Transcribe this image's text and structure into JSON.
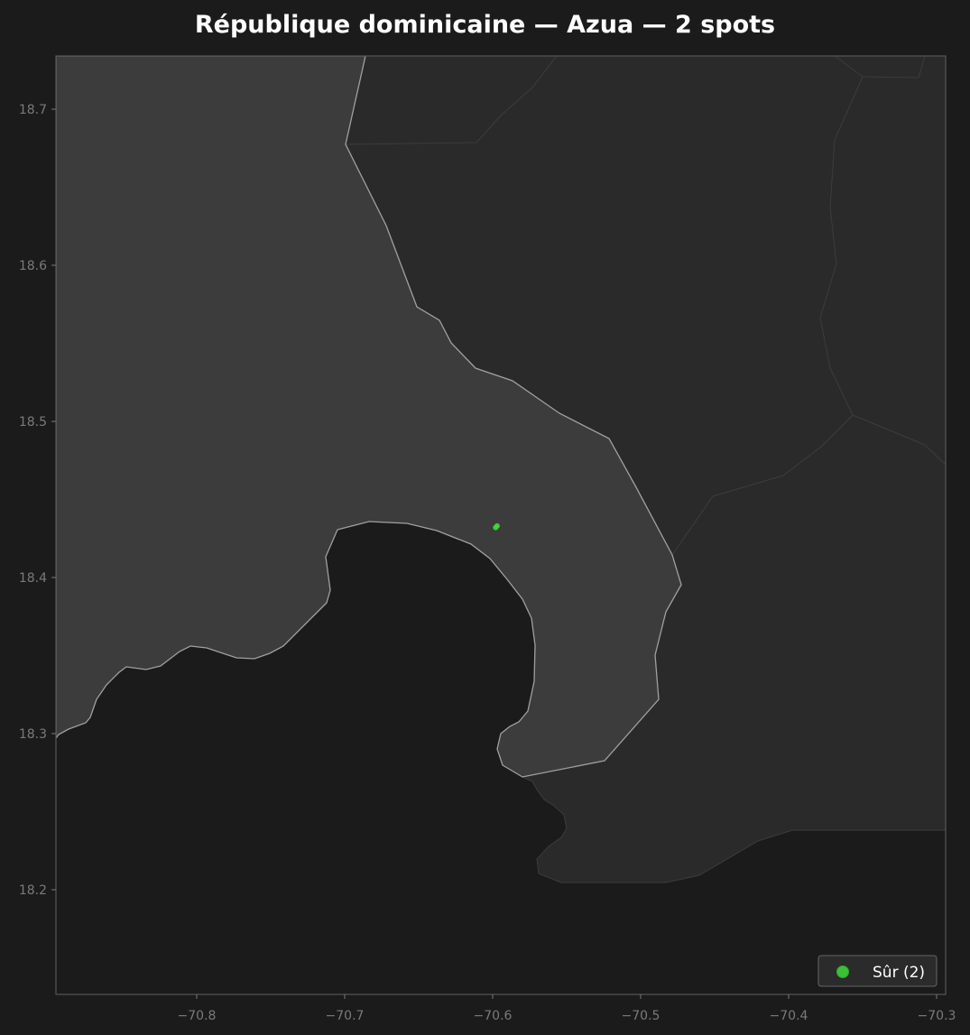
{
  "title": "République dominicaine — Azua — 2 spots",
  "colors": {
    "background": "#1b1b1b",
    "highlight_region": "#3c3c3c",
    "other_region": "#2a2a2a",
    "highlight_border": "#a0a0a0",
    "other_border": "#3c3c3c",
    "axis": "#555555",
    "tick_label": "#7a7a7a",
    "spot": "#3ddc38",
    "legend_bg": "#2b2b2b",
    "legend_border": "#666666",
    "legend_text": "#ffffff"
  },
  "axes": {
    "x_ticks": [
      "−70.8",
      "−70.7",
      "−70.6",
      "−70.5",
      "−70.4",
      "−70.3"
    ],
    "y_ticks": [
      "18.7",
      "18.6",
      "18.5",
      "18.4",
      "18.3",
      "18.2"
    ]
  },
  "map": {
    "highlight_region": "Azua",
    "spots": [
      {
        "lon": -70.598,
        "lat": 18.432,
        "category": "Sûr"
      },
      {
        "lon": -70.597,
        "lat": 18.433,
        "category": "Sûr"
      }
    ]
  },
  "legend": {
    "position": "lower-right",
    "entries": [
      {
        "label": "Sûr (2)",
        "color": "#3ddc38"
      }
    ]
  }
}
